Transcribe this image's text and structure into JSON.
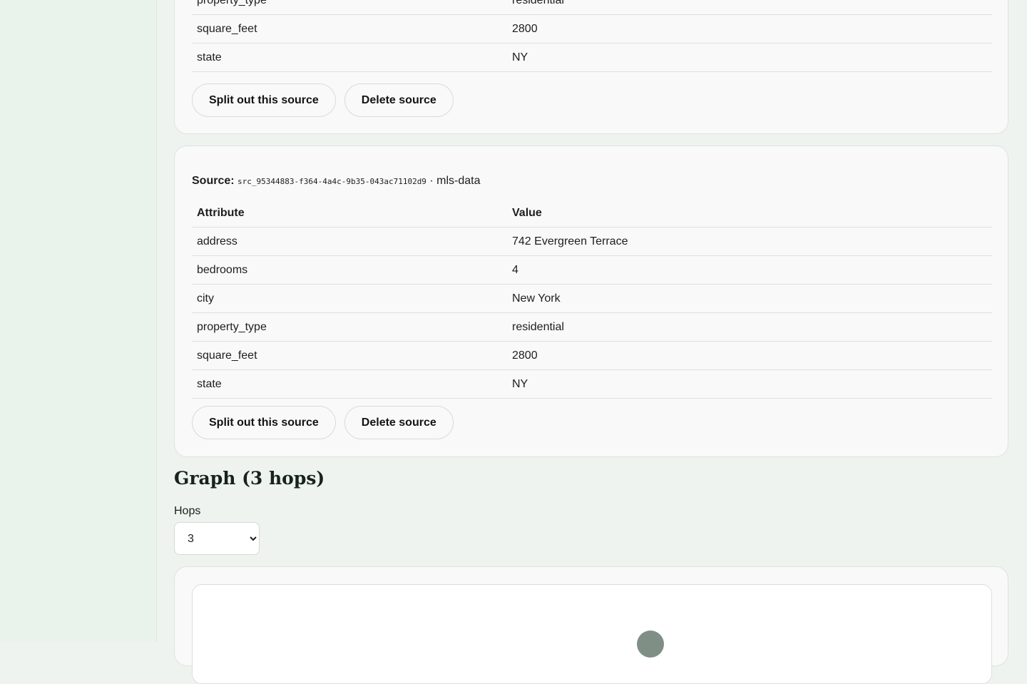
{
  "previous_source": {
    "rows": [
      {
        "attribute": "property_type",
        "value": "residential"
      },
      {
        "attribute": "square_feet",
        "value": "2800"
      },
      {
        "attribute": "state",
        "value": "NY"
      }
    ],
    "split_label": "Split out this source",
    "delete_label": "Delete source"
  },
  "source": {
    "label": "Source:",
    "id": "src_95344883-f364-4a4c-9b35-043ac71102d9",
    "separator": "·",
    "origin": "mls-data",
    "columns": {
      "attribute": "Attribute",
      "value": "Value"
    },
    "rows": [
      {
        "attribute": "address",
        "value": "742 Evergreen Terrace"
      },
      {
        "attribute": "bedrooms",
        "value": "4"
      },
      {
        "attribute": "city",
        "value": "New York"
      },
      {
        "attribute": "property_type",
        "value": "residential"
      },
      {
        "attribute": "square_feet",
        "value": "2800"
      },
      {
        "attribute": "state",
        "value": "NY"
      }
    ],
    "split_label": "Split out this source",
    "delete_label": "Delete source"
  },
  "graph": {
    "title": "Graph (3 hops)",
    "hops_label": "Hops",
    "hops_selected": "3",
    "node_color": "#7f8f85"
  }
}
